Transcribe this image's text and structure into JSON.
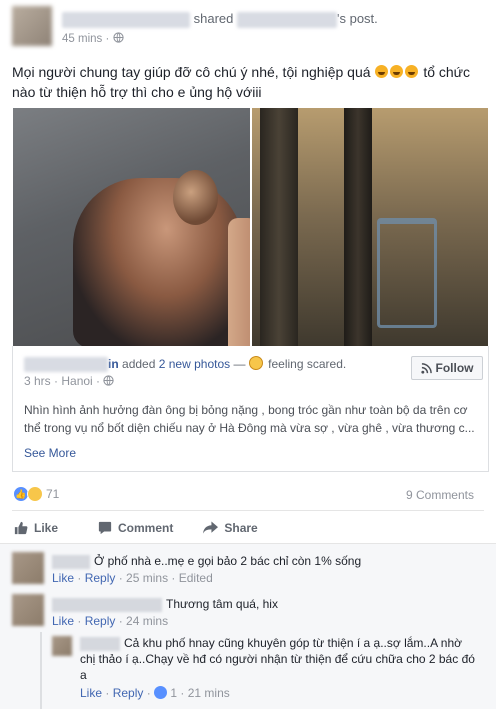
{
  "post": {
    "shared_text": "shared",
    "post_suffix": "'s post.",
    "time": "45 mins",
    "privacy_icon": "globe-icon",
    "text_line1": "Mọi người chung tay giúp đỡ cô chú ý nhé, tội nghiệp quá",
    "text_line2": "tổ chức nào từ thiện hỗ trợ thì cho e ủng hộ vớiii",
    "emoji_icon": "crying-emoji-icon"
  },
  "shared": {
    "name_suffix": "in",
    "added": "added",
    "photos_link": "2 new photos",
    "dash": "—",
    "feeling": "feeling scared.",
    "time": "3 hrs",
    "location": "Hanoi",
    "follow_label": "Follow",
    "text": "Nhìn hình ảnh hưởng đàn ông bị bỏng nặng , bong tróc gần như toàn bộ da trên cơ thể trong vụ nổ bốt diện chiếu nay ở Hà Đông mà vừa sợ , vừa ghê , vừa thương c...",
    "see_more": "See More"
  },
  "stats": {
    "reactions_count": "71",
    "comments_count": "9 Comments"
  },
  "actions": {
    "like": "Like",
    "comment": "Comment",
    "share": "Share"
  },
  "comments": [
    {
      "text": "Ở phố nhà e..mẹ e gọi bảo 2 bác chỉ còn 1% sống",
      "like": "Like",
      "reply": "Reply",
      "time": "25 mins",
      "edited": "Edited"
    },
    {
      "text": "Thương tâm quá, hix",
      "like": "Like",
      "reply": "Reply",
      "time": "24 mins"
    },
    {
      "text": "Cả khu phố hnay cũng khuyên góp từ thiện í a ạ..sợ lắm..A nhờ chị thảo í ạ..Chạy về hđ có người nhận từ thiện để cứu chữa cho 2 bác đó a",
      "like": "Like",
      "reply": "Reply",
      "likes_count": "1",
      "time": "21 mins"
    }
  ],
  "colors": {
    "link": "#365899",
    "meta": "#90949c",
    "like_blue": "#5890ff"
  }
}
